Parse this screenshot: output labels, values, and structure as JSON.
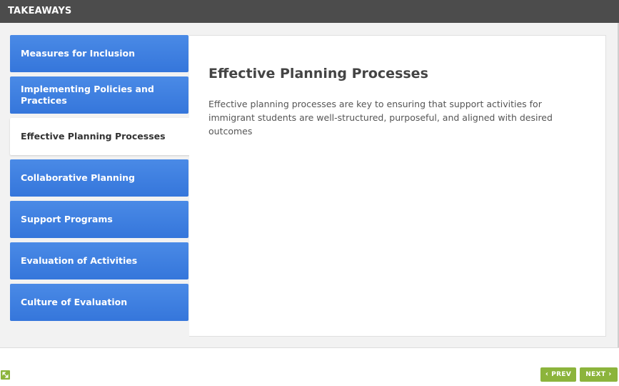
{
  "header": {
    "title": "TAKEAWAYS"
  },
  "tabs": [
    {
      "label": "Measures for Inclusion",
      "active": false
    },
    {
      "label": "Implementing Policies and Practices",
      "active": false
    },
    {
      "label": "Effective Planning Processes",
      "active": true
    },
    {
      "label": "Collaborative Planning",
      "active": false
    },
    {
      "label": "Support Programs",
      "active": false
    },
    {
      "label": "Evaluation of Activities",
      "active": false
    },
    {
      "label": "Culture of Evaluation",
      "active": false
    }
  ],
  "panel": {
    "heading": "Effective Planning Processes",
    "body": "Effective planning processes are key to ensuring that support activities for immigrant students are well-structured, purposeful, and aligned with desired outcomes"
  },
  "nav": {
    "prev_label": "PREV",
    "next_label": "NEXT",
    "prev_icon": "chevron-left-icon",
    "next_icon": "chevron-right-icon"
  },
  "colors": {
    "header": "#4c4c4c",
    "tab": "#3b7de0",
    "button": "#8cb43c"
  }
}
